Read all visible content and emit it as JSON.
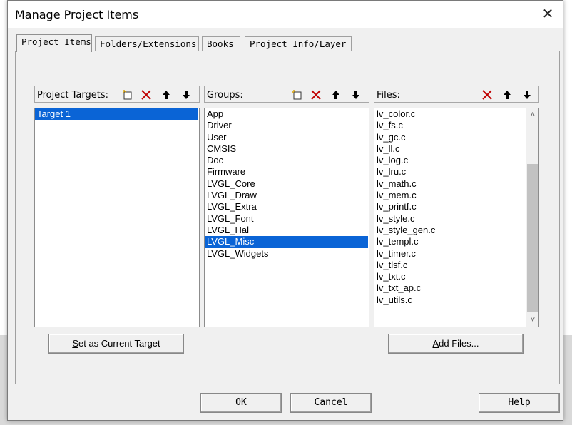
{
  "window": {
    "title": "Manage Project Items",
    "close_glyph": "✕"
  },
  "tabs": [
    {
      "label": "Project Items",
      "active": true
    },
    {
      "label": "Folders/Extensions",
      "active": false
    },
    {
      "label": "Books",
      "active": false
    },
    {
      "label": "Project Info/Layer",
      "active": false
    }
  ],
  "targets": {
    "label": "Project Targets:",
    "items": [
      "Target 1"
    ],
    "selected": 0,
    "toolbar": [
      "new-icon",
      "delete-icon",
      "move-up-icon",
      "move-down-icon"
    ]
  },
  "groups": {
    "label": "Groups:",
    "items": [
      "App",
      "Driver",
      "User",
      "CMSIS",
      "Doc",
      "Firmware",
      "LVGL_Core",
      "LVGL_Draw",
      "LVGL_Extra",
      "LVGL_Font",
      "LVGL_Hal",
      "LVGL_Misc",
      "LVGL_Widgets"
    ],
    "selected": 11,
    "toolbar": [
      "new-icon",
      "delete-icon",
      "move-up-icon",
      "move-down-icon"
    ]
  },
  "files": {
    "label": "Files:",
    "items": [
      "lv_color.c",
      "lv_fs.c",
      "lv_gc.c",
      "lv_ll.c",
      "lv_log.c",
      "lv_lru.c",
      "lv_math.c",
      "lv_mem.c",
      "lv_printf.c",
      "lv_style.c",
      "lv_style_gen.c",
      "lv_templ.c",
      "lv_timer.c",
      "lv_tlsf.c",
      "lv_txt.c",
      "lv_txt_ap.c",
      "lv_utils.c"
    ],
    "toolbar": [
      "delete-icon",
      "move-up-icon",
      "move-down-icon"
    ],
    "scroll_up_glyph": "˄",
    "scroll_down_glyph": "˅"
  },
  "buttons": {
    "set_target_hotkey": "S",
    "set_target_rest": "et as Current Target",
    "add_files_hotkey": "A",
    "add_files_rest": "dd Files...",
    "ok": "OK",
    "cancel": "Cancel",
    "help": "Help"
  },
  "colors": {
    "selection": "#0a64d6",
    "delete_red": "#c00000"
  }
}
